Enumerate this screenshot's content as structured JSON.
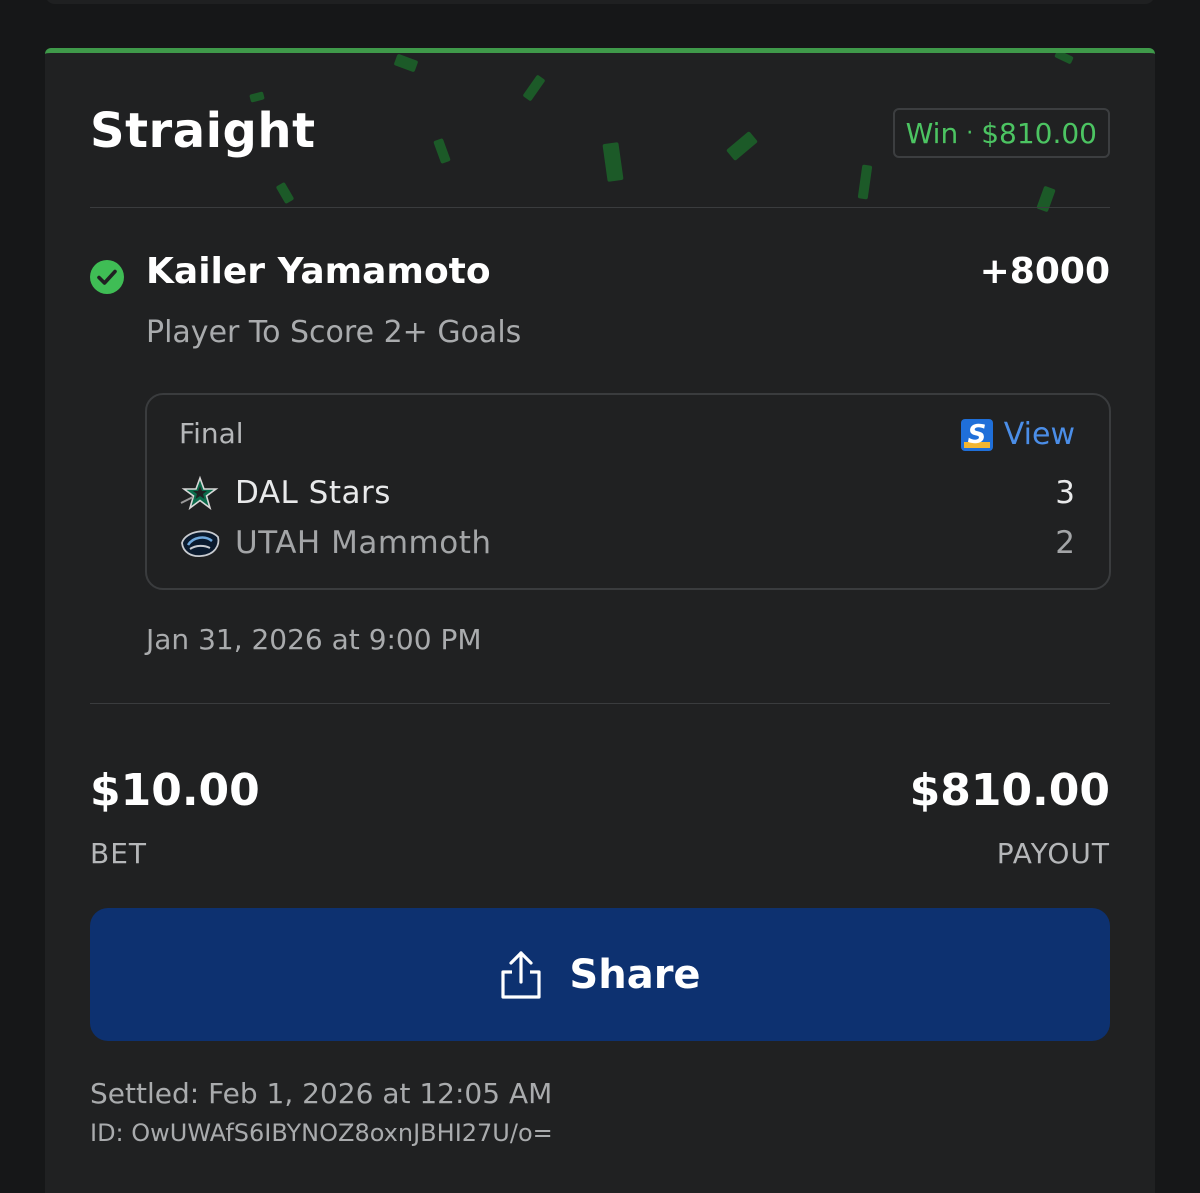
{
  "bet": {
    "type_label": "Straight",
    "result": {
      "status": "Win",
      "separator": "·",
      "amount": "$810.00",
      "color": "#4cc462"
    },
    "selection": {
      "player": "Kailer Yamamoto",
      "odds": "+8000",
      "market": "Player To Score 2+ Goals",
      "status_icon": "check-circle-icon"
    },
    "game": {
      "status": "Final",
      "view_label": "View",
      "view_icon": "sportsbook-s-icon",
      "teams": [
        {
          "name": "DAL Stars",
          "score": "3",
          "logo_icon": "dallas-stars-logo-icon"
        },
        {
          "name": "UTAH Mammoth",
          "score": "2",
          "logo_icon": "utah-mammoth-logo-icon"
        }
      ],
      "start_time": "Jan 31, 2026 at 9:00 PM"
    },
    "wager": {
      "bet_amount": "$10.00",
      "bet_label": "BET",
      "payout_amount": "$810.00",
      "payout_label": "PAYOUT"
    },
    "share": {
      "label": "Share",
      "icon": "share-icon"
    },
    "settled": "Settled: Feb 1, 2026 at 12:05 AM",
    "id": "ID: OwUWAfS6IBYNOZ8oxnJBHI27U/o="
  },
  "colors": {
    "accent_green": "#3f9a4a",
    "win_text": "#4cc462",
    "share_button": "#0d3170",
    "link_blue": "#4b8ee8",
    "card_bg": "#202122"
  }
}
